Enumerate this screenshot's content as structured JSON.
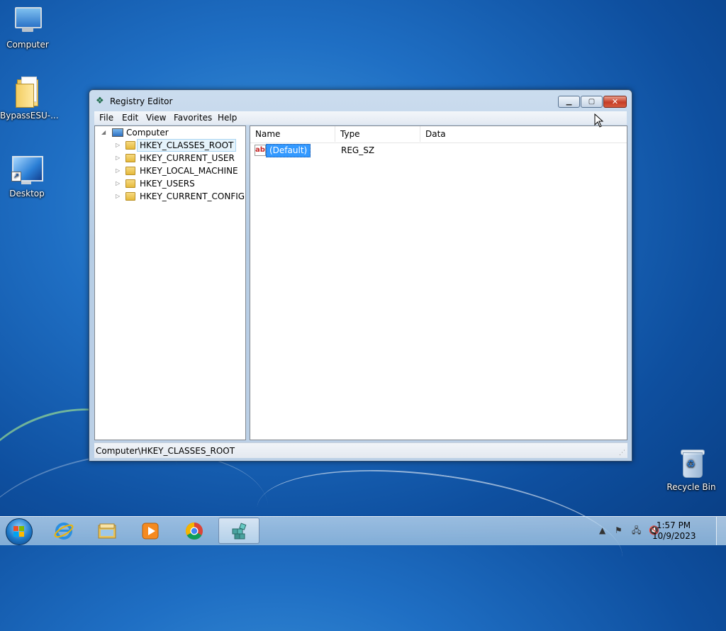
{
  "desktop": {
    "icons": [
      {
        "label": "Computer"
      },
      {
        "label": "BypassESU-..."
      },
      {
        "label": "Desktop"
      },
      {
        "label": "Recycle Bin"
      }
    ]
  },
  "window": {
    "title": "Registry Editor",
    "menu": [
      "File",
      "Edit",
      "View",
      "Favorites",
      "Help"
    ],
    "tree": {
      "root": "Computer",
      "items": [
        "HKEY_CLASSES_ROOT",
        "HKEY_CURRENT_USER",
        "HKEY_LOCAL_MACHINE",
        "HKEY_USERS",
        "HKEY_CURRENT_CONFIG"
      ],
      "selected_index": 0
    },
    "list": {
      "columns": [
        "Name",
        "Type",
        "Data"
      ],
      "rows": [
        {
          "name": "(Default)",
          "type": "REG_SZ",
          "data": ""
        }
      ]
    },
    "status": "Computer\\HKEY_CLASSES_ROOT"
  },
  "taskbar": {
    "clock_time": "1:57 PM",
    "clock_date": "10/9/2023",
    "tray_overflow": "▲"
  },
  "icons": {
    "app": "registry-editor-icon",
    "value": "string-value-icon"
  },
  "colors": {
    "selection": "#3399ff",
    "close_button": "#c63d26",
    "desktop": "#1f6fc4"
  }
}
